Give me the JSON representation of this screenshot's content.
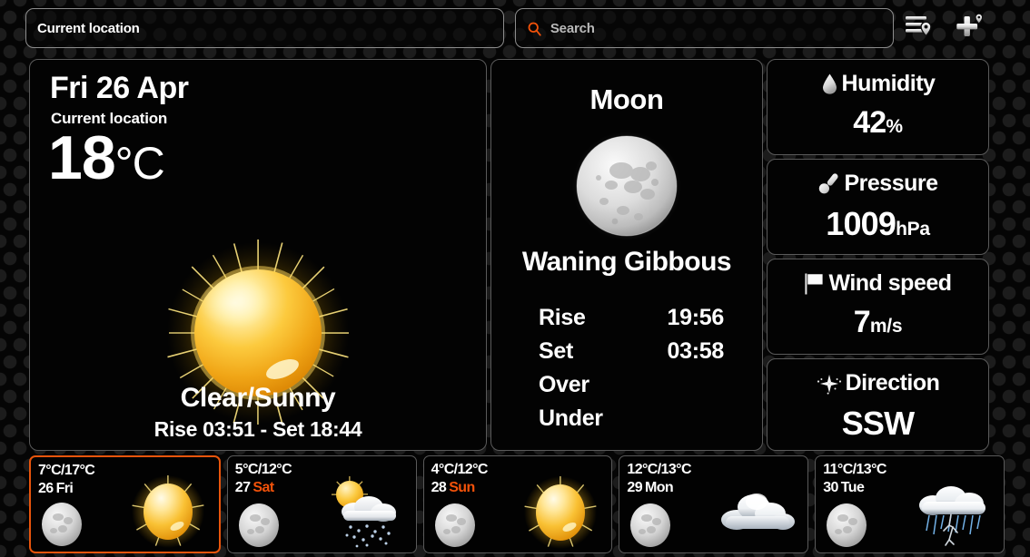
{
  "topbar": {
    "location_value": "Current location",
    "search_placeholder": "Search",
    "icons": {
      "list": "location-list-icon",
      "add": "add-location-icon",
      "search": "search-icon"
    }
  },
  "current": {
    "date": "Fri 26 Apr",
    "location": "Current location",
    "temperature": "18",
    "temperature_unit": "°C",
    "condition": "Clear/Sunny",
    "sun_line": "Rise 03:51 - Set 18:44",
    "icon": "sun-icon"
  },
  "moon": {
    "title": "Moon",
    "phase": "Waning Gibbous",
    "icon": "moon-icon",
    "rows": [
      {
        "label": "Rise",
        "value": "19:56"
      },
      {
        "label": "Set",
        "value": "03:58"
      },
      {
        "label": "Over",
        "value": ""
      },
      {
        "label": "Under",
        "value": ""
      }
    ]
  },
  "metrics": [
    {
      "label": "Humidity",
      "value": "42",
      "suffix": "%",
      "icon": "water-drop-icon"
    },
    {
      "label": "Pressure",
      "value": "1009",
      "suffix": "hPa",
      "icon": "thermometer-icon"
    },
    {
      "label": "Wind speed",
      "value": "7",
      "suffix": "m/s",
      "icon": "flag-icon"
    },
    {
      "label": "Direction",
      "value": "SSW",
      "suffix": "",
      "icon": "compass-icon"
    }
  ],
  "forecast": [
    {
      "temps": "7°C/17°C",
      "date": "26",
      "dow": "Fri",
      "weekend": false,
      "selected": true,
      "icon": "sun-icon",
      "moon": "moon-icon"
    },
    {
      "temps": "5°C/12°C",
      "date": "27",
      "dow": "Sat",
      "weekend": true,
      "selected": false,
      "icon": "sun-rain-icon",
      "moon": "moon-icon"
    },
    {
      "temps": "4°C/12°C",
      "date": "28",
      "dow": "Sun",
      "weekend": true,
      "selected": false,
      "icon": "sun-icon",
      "moon": "moon-icon"
    },
    {
      "temps": "12°C/13°C",
      "date": "29",
      "dow": "Mon",
      "weekend": false,
      "selected": false,
      "icon": "cloud-icon",
      "moon": "moon-icon"
    },
    {
      "temps": "11°C/13°C",
      "date": "30",
      "dow": "Tue",
      "weekend": false,
      "selected": false,
      "icon": "thunderstorm-icon",
      "moon": "moon-icon"
    }
  ],
  "colors": {
    "accent": "#e8550c",
    "search_accent": "#f2520a",
    "panel_border": "#5a5a5a",
    "background": "#050505",
    "text": "#ffffff"
  }
}
